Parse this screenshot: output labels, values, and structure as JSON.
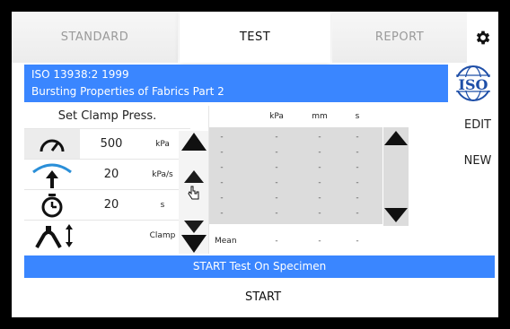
{
  "tabs": [
    {
      "label": "STANDARD",
      "active": false
    },
    {
      "label": "TEST",
      "active": true
    },
    {
      "label": "REPORT",
      "active": false
    }
  ],
  "banner": {
    "line1": "ISO 13938:2 1999",
    "line2": "Bursting Properties of Fabrics Part 2",
    "color": "#3a86ff"
  },
  "logo_text": "ISO",
  "side_buttons": {
    "edit": "EDIT",
    "new": "NEW"
  },
  "clamp_panel": {
    "title": "Set Clamp Press.",
    "rows": [
      {
        "icon": "pressure-gauge-icon",
        "value": "500",
        "unit": "kPa"
      },
      {
        "icon": "inflation-rate-icon",
        "value": "20",
        "unit": "kPa/s"
      },
      {
        "icon": "timer-icon",
        "value": "20",
        "unit": "s"
      },
      {
        "icon": "clamp-icon",
        "value": "",
        "unit": "Clamp"
      }
    ]
  },
  "results": {
    "headers": [
      "kPa",
      "mm",
      "s"
    ],
    "rows": [
      [
        "-",
        "-",
        "-",
        "-"
      ],
      [
        "-",
        "-",
        "-",
        "-"
      ],
      [
        "-",
        "-",
        "-",
        "-"
      ],
      [
        "-",
        "-",
        "-",
        "-"
      ],
      [
        "-",
        "-",
        "-",
        "-"
      ],
      [
        "-",
        "-",
        "-",
        "-"
      ]
    ],
    "mean_label": "Mean",
    "mean_values": [
      "-",
      "-",
      "-"
    ]
  },
  "status_bar": "START Test On Specimen",
  "start_button": "START"
}
